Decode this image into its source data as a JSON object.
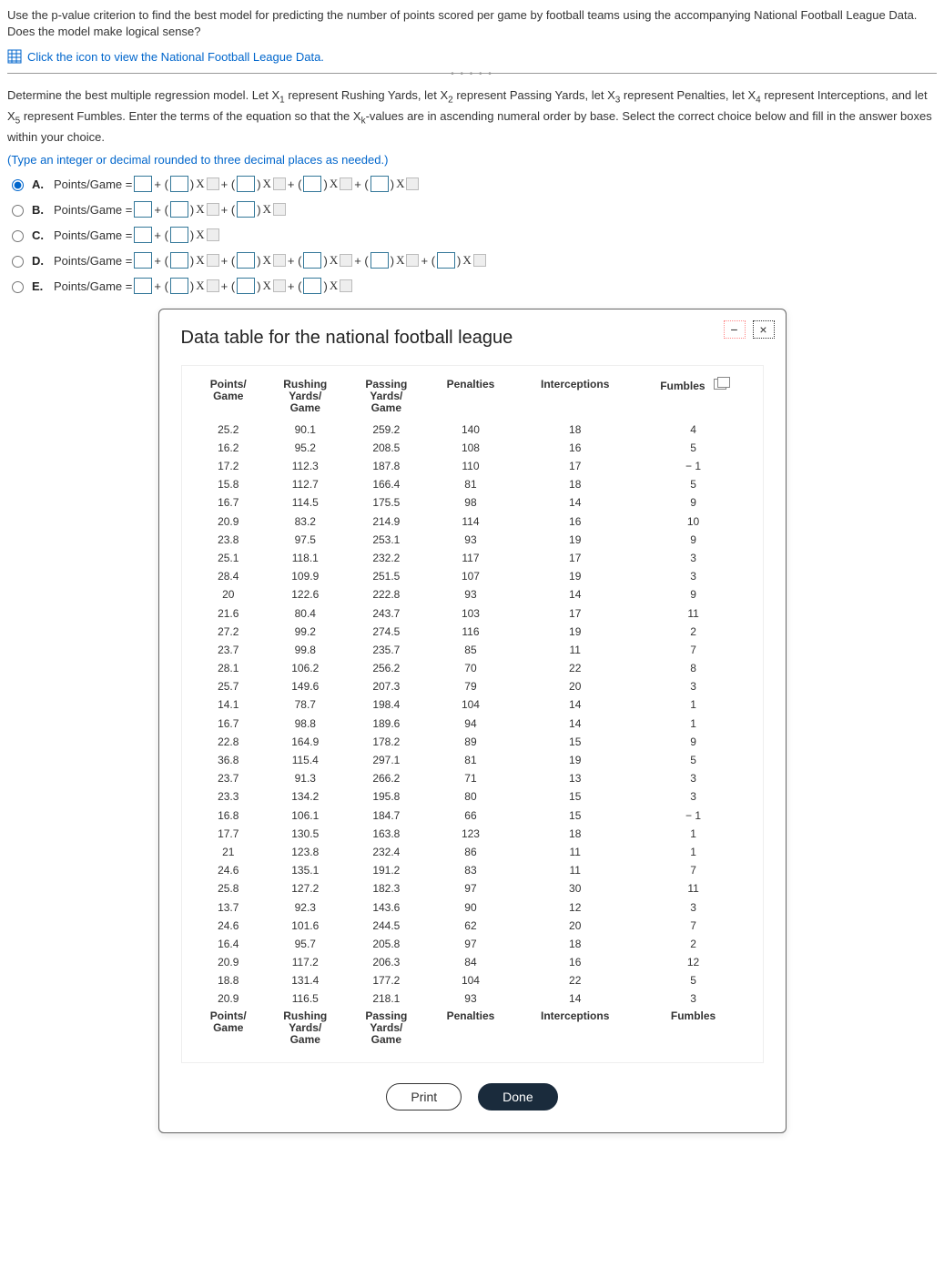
{
  "prompt": {
    "text1": "Use the p-value criterion to find the best model for predicting the number of points scored per game by football teams using the accompanying National Football League Data. Does the model make logical sense?",
    "link": "Click the icon to view the National Football League Data.",
    "text2_part1": "Determine the best multiple regression model. Let X",
    "text2_part2": " represent Rushing Yards, let X",
    "text2_part3": " represent Passing Yards, let X",
    "text2_part4": " represent Penalties, let X",
    "text2_part5": " represent Interceptions, and let X",
    "text2_part6": " represent Fumbles. Enter the terms of the equation so that the X",
    "text2_part7": "-values are in ascending numeral order by base. Select the correct choice below and fill in the answer boxes within your choice.",
    "hint": "(Type an integer or decimal rounded to three decimal places as needed.)"
  },
  "choices": {
    "A": "A.",
    "B": "B.",
    "C": "C.",
    "D": "D.",
    "E": "E.",
    "prefix": "Points/Game ="
  },
  "modal": {
    "title": "Data table for the national football league",
    "print": "Print",
    "done": "Done",
    "close": "×",
    "min": "−"
  },
  "table": {
    "headers": [
      "Points/ Game",
      "Rushing Yards/ Game",
      "Passing Yards/ Game",
      "Penalties",
      "Interceptions",
      "Fumbles"
    ],
    "rows": [
      [
        25.2,
        90.1,
        259.2,
        140,
        18,
        4
      ],
      [
        16.2,
        95.2,
        208.5,
        108,
        16,
        5
      ],
      [
        17.2,
        112.3,
        187.8,
        110,
        17,
        "− 1"
      ],
      [
        15.8,
        112.7,
        166.4,
        81,
        18,
        5
      ],
      [
        16.7,
        114.5,
        175.5,
        98,
        14,
        9
      ],
      [
        20.9,
        83.2,
        214.9,
        114,
        16,
        10
      ],
      [
        23.8,
        97.5,
        253.1,
        93,
        19,
        9
      ],
      [
        25.1,
        118.1,
        232.2,
        117,
        17,
        3
      ],
      [
        28.4,
        109.9,
        251.5,
        107,
        19,
        3
      ],
      [
        20.0,
        122.6,
        222.8,
        93,
        14,
        9
      ],
      [
        21.6,
        80.4,
        243.7,
        103,
        17,
        11
      ],
      [
        27.2,
        99.2,
        274.5,
        116,
        19,
        2
      ],
      [
        23.7,
        99.8,
        235.7,
        85,
        11,
        7
      ],
      [
        28.1,
        106.2,
        256.2,
        70,
        22,
        8
      ],
      [
        25.7,
        149.6,
        207.3,
        79,
        20,
        3
      ],
      [
        14.1,
        78.7,
        198.4,
        104,
        14,
        1
      ],
      [
        16.7,
        98.8,
        189.6,
        94,
        14,
        1
      ],
      [
        22.8,
        164.9,
        178.2,
        89,
        15,
        9
      ],
      [
        36.8,
        115.4,
        297.1,
        81,
        19,
        5
      ],
      [
        23.7,
        91.3,
        266.2,
        71,
        13,
        3
      ],
      [
        23.3,
        134.2,
        195.8,
        80,
        15,
        3
      ],
      [
        16.8,
        106.1,
        184.7,
        66,
        15,
        "− 1"
      ],
      [
        17.7,
        130.5,
        163.8,
        123,
        18,
        1
      ],
      [
        21.0,
        123.8,
        232.4,
        86,
        11,
        1
      ],
      [
        24.6,
        135.1,
        191.2,
        83,
        11,
        7
      ],
      [
        25.8,
        127.2,
        182.3,
        97,
        30,
        11
      ],
      [
        13.7,
        92.3,
        143.6,
        90,
        12,
        3
      ],
      [
        24.6,
        101.6,
        244.5,
        62,
        20,
        7
      ],
      [
        16.4,
        95.7,
        205.8,
        97,
        18,
        2
      ],
      [
        20.9,
        117.2,
        206.3,
        84,
        16,
        12
      ],
      [
        18.8,
        131.4,
        177.2,
        104,
        22,
        5
      ],
      [
        20.9,
        116.5,
        218.1,
        93,
        14,
        3
      ]
    ]
  }
}
